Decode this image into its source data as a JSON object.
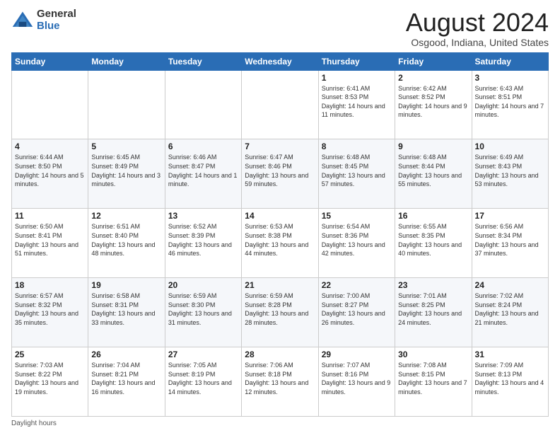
{
  "logo": {
    "general": "General",
    "blue": "Blue"
  },
  "header": {
    "month": "August 2024",
    "location": "Osgood, Indiana, United States"
  },
  "weekdays": [
    "Sunday",
    "Monday",
    "Tuesday",
    "Wednesday",
    "Thursday",
    "Friday",
    "Saturday"
  ],
  "weeks": [
    [
      {
        "day": "",
        "info": ""
      },
      {
        "day": "",
        "info": ""
      },
      {
        "day": "",
        "info": ""
      },
      {
        "day": "",
        "info": ""
      },
      {
        "day": "1",
        "info": "Sunrise: 6:41 AM\nSunset: 8:53 PM\nDaylight: 14 hours and 11 minutes."
      },
      {
        "day": "2",
        "info": "Sunrise: 6:42 AM\nSunset: 8:52 PM\nDaylight: 14 hours and 9 minutes."
      },
      {
        "day": "3",
        "info": "Sunrise: 6:43 AM\nSunset: 8:51 PM\nDaylight: 14 hours and 7 minutes."
      }
    ],
    [
      {
        "day": "4",
        "info": "Sunrise: 6:44 AM\nSunset: 8:50 PM\nDaylight: 14 hours and 5 minutes."
      },
      {
        "day": "5",
        "info": "Sunrise: 6:45 AM\nSunset: 8:49 PM\nDaylight: 14 hours and 3 minutes."
      },
      {
        "day": "6",
        "info": "Sunrise: 6:46 AM\nSunset: 8:47 PM\nDaylight: 14 hours and 1 minute."
      },
      {
        "day": "7",
        "info": "Sunrise: 6:47 AM\nSunset: 8:46 PM\nDaylight: 13 hours and 59 minutes."
      },
      {
        "day": "8",
        "info": "Sunrise: 6:48 AM\nSunset: 8:45 PM\nDaylight: 13 hours and 57 minutes."
      },
      {
        "day": "9",
        "info": "Sunrise: 6:48 AM\nSunset: 8:44 PM\nDaylight: 13 hours and 55 minutes."
      },
      {
        "day": "10",
        "info": "Sunrise: 6:49 AM\nSunset: 8:43 PM\nDaylight: 13 hours and 53 minutes."
      }
    ],
    [
      {
        "day": "11",
        "info": "Sunrise: 6:50 AM\nSunset: 8:41 PM\nDaylight: 13 hours and 51 minutes."
      },
      {
        "day": "12",
        "info": "Sunrise: 6:51 AM\nSunset: 8:40 PM\nDaylight: 13 hours and 48 minutes."
      },
      {
        "day": "13",
        "info": "Sunrise: 6:52 AM\nSunset: 8:39 PM\nDaylight: 13 hours and 46 minutes."
      },
      {
        "day": "14",
        "info": "Sunrise: 6:53 AM\nSunset: 8:38 PM\nDaylight: 13 hours and 44 minutes."
      },
      {
        "day": "15",
        "info": "Sunrise: 6:54 AM\nSunset: 8:36 PM\nDaylight: 13 hours and 42 minutes."
      },
      {
        "day": "16",
        "info": "Sunrise: 6:55 AM\nSunset: 8:35 PM\nDaylight: 13 hours and 40 minutes."
      },
      {
        "day": "17",
        "info": "Sunrise: 6:56 AM\nSunset: 8:34 PM\nDaylight: 13 hours and 37 minutes."
      }
    ],
    [
      {
        "day": "18",
        "info": "Sunrise: 6:57 AM\nSunset: 8:32 PM\nDaylight: 13 hours and 35 minutes."
      },
      {
        "day": "19",
        "info": "Sunrise: 6:58 AM\nSunset: 8:31 PM\nDaylight: 13 hours and 33 minutes."
      },
      {
        "day": "20",
        "info": "Sunrise: 6:59 AM\nSunset: 8:30 PM\nDaylight: 13 hours and 31 minutes."
      },
      {
        "day": "21",
        "info": "Sunrise: 6:59 AM\nSunset: 8:28 PM\nDaylight: 13 hours and 28 minutes."
      },
      {
        "day": "22",
        "info": "Sunrise: 7:00 AM\nSunset: 8:27 PM\nDaylight: 13 hours and 26 minutes."
      },
      {
        "day": "23",
        "info": "Sunrise: 7:01 AM\nSunset: 8:25 PM\nDaylight: 13 hours and 24 minutes."
      },
      {
        "day": "24",
        "info": "Sunrise: 7:02 AM\nSunset: 8:24 PM\nDaylight: 13 hours and 21 minutes."
      }
    ],
    [
      {
        "day": "25",
        "info": "Sunrise: 7:03 AM\nSunset: 8:22 PM\nDaylight: 13 hours and 19 minutes."
      },
      {
        "day": "26",
        "info": "Sunrise: 7:04 AM\nSunset: 8:21 PM\nDaylight: 13 hours and 16 minutes."
      },
      {
        "day": "27",
        "info": "Sunrise: 7:05 AM\nSunset: 8:19 PM\nDaylight: 13 hours and 14 minutes."
      },
      {
        "day": "28",
        "info": "Sunrise: 7:06 AM\nSunset: 8:18 PM\nDaylight: 13 hours and 12 minutes."
      },
      {
        "day": "29",
        "info": "Sunrise: 7:07 AM\nSunset: 8:16 PM\nDaylight: 13 hours and 9 minutes."
      },
      {
        "day": "30",
        "info": "Sunrise: 7:08 AM\nSunset: 8:15 PM\nDaylight: 13 hours and 7 minutes."
      },
      {
        "day": "31",
        "info": "Sunrise: 7:09 AM\nSunset: 8:13 PM\nDaylight: 13 hours and 4 minutes."
      }
    ]
  ],
  "footer": {
    "note": "Daylight hours"
  }
}
